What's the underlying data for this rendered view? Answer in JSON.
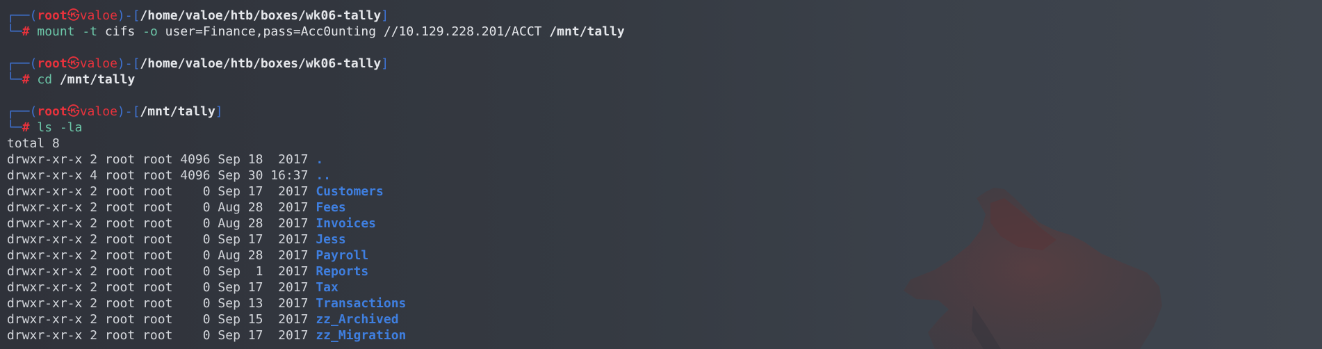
{
  "colors": {
    "frame": "#3f74d6",
    "user_red": "#e8323c",
    "command_green": "#6cc6a8",
    "dir_blue": "#3f7fe0",
    "text": "#d4d7dc",
    "background": "#353a42"
  },
  "prompt": {
    "top_left": "┌──(",
    "user": "root",
    "at_symbol": "㉿",
    "host": "valoe",
    "sep": ")-[",
    "close": "]",
    "bottom_left": "└─",
    "hash": "#"
  },
  "blocks": [
    {
      "path": "/home/valoe/htb/boxes/wk06-tally",
      "command": {
        "cmd": "mount",
        "parts": [
          {
            "t": " ",
            "c": "arg"
          },
          {
            "t": "-t",
            "c": "opt"
          },
          {
            "t": " cifs ",
            "c": "arg"
          },
          {
            "t": "-o",
            "c": "opt"
          },
          {
            "t": " user=Finance,pass=Acc0unting //10.129.228.201/ACCT ",
            "c": "arg"
          },
          {
            "t": "/mnt/tally",
            "c": "argb"
          }
        ]
      }
    },
    {
      "path": "/home/valoe/htb/boxes/wk06-tally",
      "command": {
        "cmd": "cd",
        "parts": [
          {
            "t": " ",
            "c": "arg"
          },
          {
            "t": "/mnt/tally",
            "c": "argb"
          }
        ]
      }
    },
    {
      "path": "/mnt/tally",
      "command": {
        "cmd": "ls",
        "parts": [
          {
            "t": " ",
            "c": "arg"
          },
          {
            "t": "-la",
            "c": "opt"
          }
        ]
      }
    }
  ],
  "ls_output": {
    "total": "total 8",
    "rows": [
      {
        "meta": "drwxr-xr-x 2 root root 4096 Sep 18  2017 ",
        "name": "."
      },
      {
        "meta": "drwxr-xr-x 4 root root 4096 Sep 30 16:37 ",
        "name": ".."
      },
      {
        "meta": "drwxr-xr-x 2 root root    0 Sep 17  2017 ",
        "name": "Customers"
      },
      {
        "meta": "drwxr-xr-x 2 root root    0 Aug 28  2017 ",
        "name": "Fees"
      },
      {
        "meta": "drwxr-xr-x 2 root root    0 Aug 28  2017 ",
        "name": "Invoices"
      },
      {
        "meta": "drwxr-xr-x 2 root root    0 Sep 17  2017 ",
        "name": "Jess"
      },
      {
        "meta": "drwxr-xr-x 2 root root    0 Aug 28  2017 ",
        "name": "Payroll"
      },
      {
        "meta": "drwxr-xr-x 2 root root    0 Sep  1  2017 ",
        "name": "Reports"
      },
      {
        "meta": "drwxr-xr-x 2 root root    0 Sep 17  2017 ",
        "name": "Tax"
      },
      {
        "meta": "drwxr-xr-x 2 root root    0 Sep 13  2017 ",
        "name": "Transactions"
      },
      {
        "meta": "drwxr-xr-x 2 root root    0 Sep 15  2017 ",
        "name": "zz_Archived"
      },
      {
        "meta": "drwxr-xr-x 2 root root    0 Sep 17  2017 ",
        "name": "zz_Migration"
      }
    ]
  },
  "wallpaper": {
    "icon": "fox-silhouette-icon"
  }
}
